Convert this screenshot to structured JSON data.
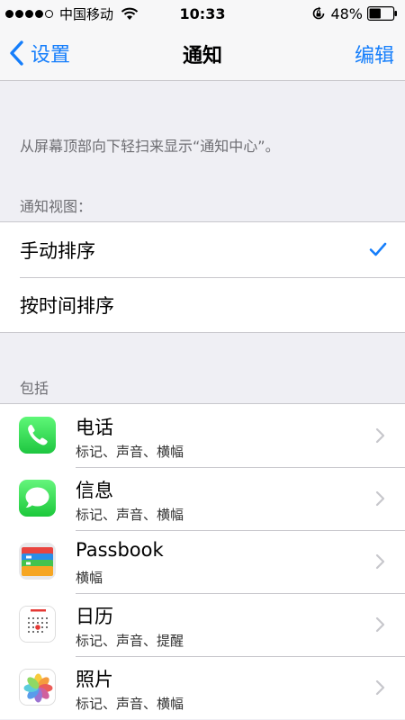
{
  "status_bar": {
    "carrier": "中国移动",
    "time": "10:33",
    "battery": "48%",
    "signal_bars_filled": 4,
    "signal_bars_total": 5
  },
  "nav": {
    "back_label": "设置",
    "title": "通知",
    "edit_label": "编辑"
  },
  "hint": "从屏幕顶部向下轻扫来显示“通知中心”。",
  "view_section": {
    "header": "通知视图：",
    "options": [
      {
        "label": "手动排序",
        "selected": true
      },
      {
        "label": "按时间排序",
        "selected": false
      }
    ]
  },
  "include_section": {
    "header": "包括",
    "apps": [
      {
        "name": "电话",
        "detail": "标记、声音、横幅",
        "icon": "phone-icon"
      },
      {
        "name": "信息",
        "detail": "标记、声音、横幅",
        "icon": "messages-icon"
      },
      {
        "name": "Passbook",
        "detail": "横幅",
        "icon": "passbook-icon"
      },
      {
        "name": "日历",
        "detail": "标记、声音、提醒",
        "icon": "calendar-icon"
      },
      {
        "name": "照片",
        "detail": "标记、声音、横幅",
        "icon": "photos-icon"
      }
    ]
  },
  "colors": {
    "accent": "#157efb",
    "background": "#efeff4",
    "separator": "#c8c7cc"
  }
}
